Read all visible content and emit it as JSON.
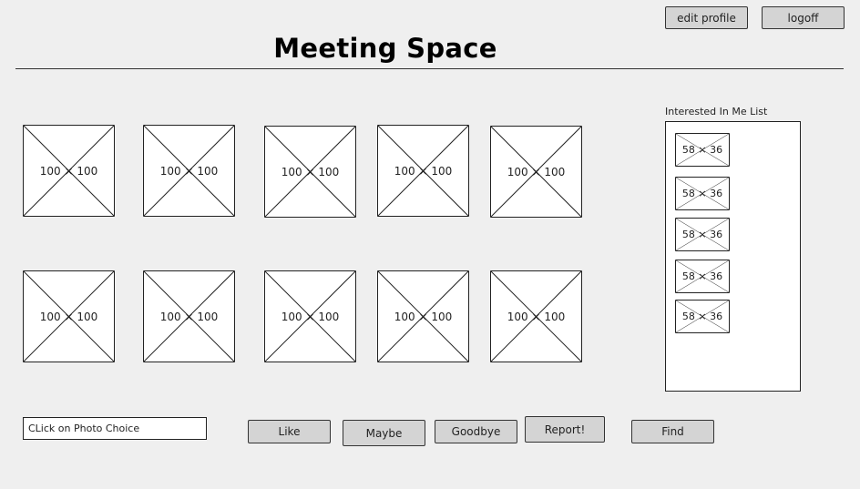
{
  "header": {
    "title": "Meeting Space",
    "edit_profile_label": "edit profile",
    "logoff_label": "logoff"
  },
  "photo_grid": {
    "photos": [
      {
        "caption": "100 × 100"
      },
      {
        "caption": "100 × 100"
      },
      {
        "caption": "100 × 100"
      },
      {
        "caption": "100 × 100"
      },
      {
        "caption": "100 × 100"
      },
      {
        "caption": "100 × 100"
      },
      {
        "caption": "100 × 100"
      },
      {
        "caption": "100 × 100"
      },
      {
        "caption": "100 × 100"
      },
      {
        "caption": "100 × 100"
      }
    ]
  },
  "interested_list": {
    "label": "Interested In Me List",
    "items": [
      {
        "caption": "58 × 36"
      },
      {
        "caption": "58 × 36"
      },
      {
        "caption": "58 × 36"
      },
      {
        "caption": "58 × 36"
      },
      {
        "caption": "58 × 36"
      }
    ]
  },
  "actions": {
    "photo_choice_placeholder": "CLick on Photo Choice",
    "like_label": "Like",
    "maybe_label": "Maybe",
    "goodbye_label": "Goodbye",
    "report_label": "Report!",
    "find_label": "Find"
  }
}
